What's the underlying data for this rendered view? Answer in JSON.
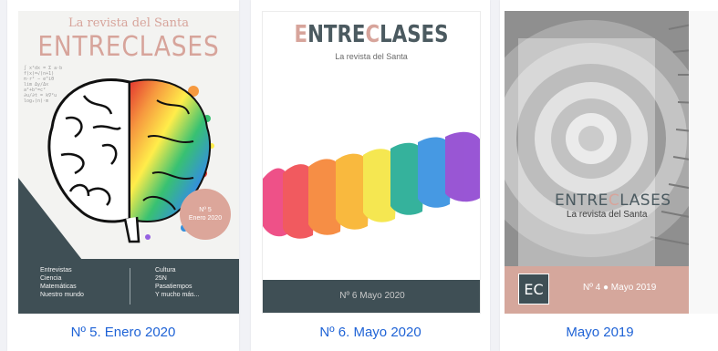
{
  "issues": [
    {
      "caption": "Nº 5. Enero 2020",
      "cover": {
        "kicker": "La revista del Santa",
        "masthead": "ENTRECLASES",
        "badge_line1": "Nº 5",
        "badge_line2": "Enero 2020",
        "topics_left": [
          "Entrevistas",
          "Ciencia",
          "Matemáticas",
          "Nuestro mundo"
        ],
        "topics_right": [
          "Cultura",
          "25N",
          "Pasatiempos",
          "Y mucho más..."
        ]
      }
    },
    {
      "caption": "Nº 6. Mayo 2020",
      "cover": {
        "masthead_a": "E",
        "masthead_b": "NTRE",
        "masthead_c": "C",
        "masthead_d": "LASES",
        "subtitle": "La revista del Santa",
        "footer": "Nº 6    Mayo 2020"
      }
    },
    {
      "caption": "Mayo 2019",
      "cover": {
        "masthead_a": "ENTRE",
        "masthead_b": "C",
        "masthead_c": "LASES",
        "subtitle": "La revista del Santa",
        "logo": "EC",
        "issue": "Nº 4 ● Mayo 2019"
      }
    }
  ],
  "colors": {
    "accent": "#d7a49b",
    "dark_band": "#3f4f55",
    "caption_link": "#1f63d6"
  },
  "icons": [
    "brain-illustration",
    "watercolor-rainbow",
    "spiral-staircase-photo"
  ]
}
